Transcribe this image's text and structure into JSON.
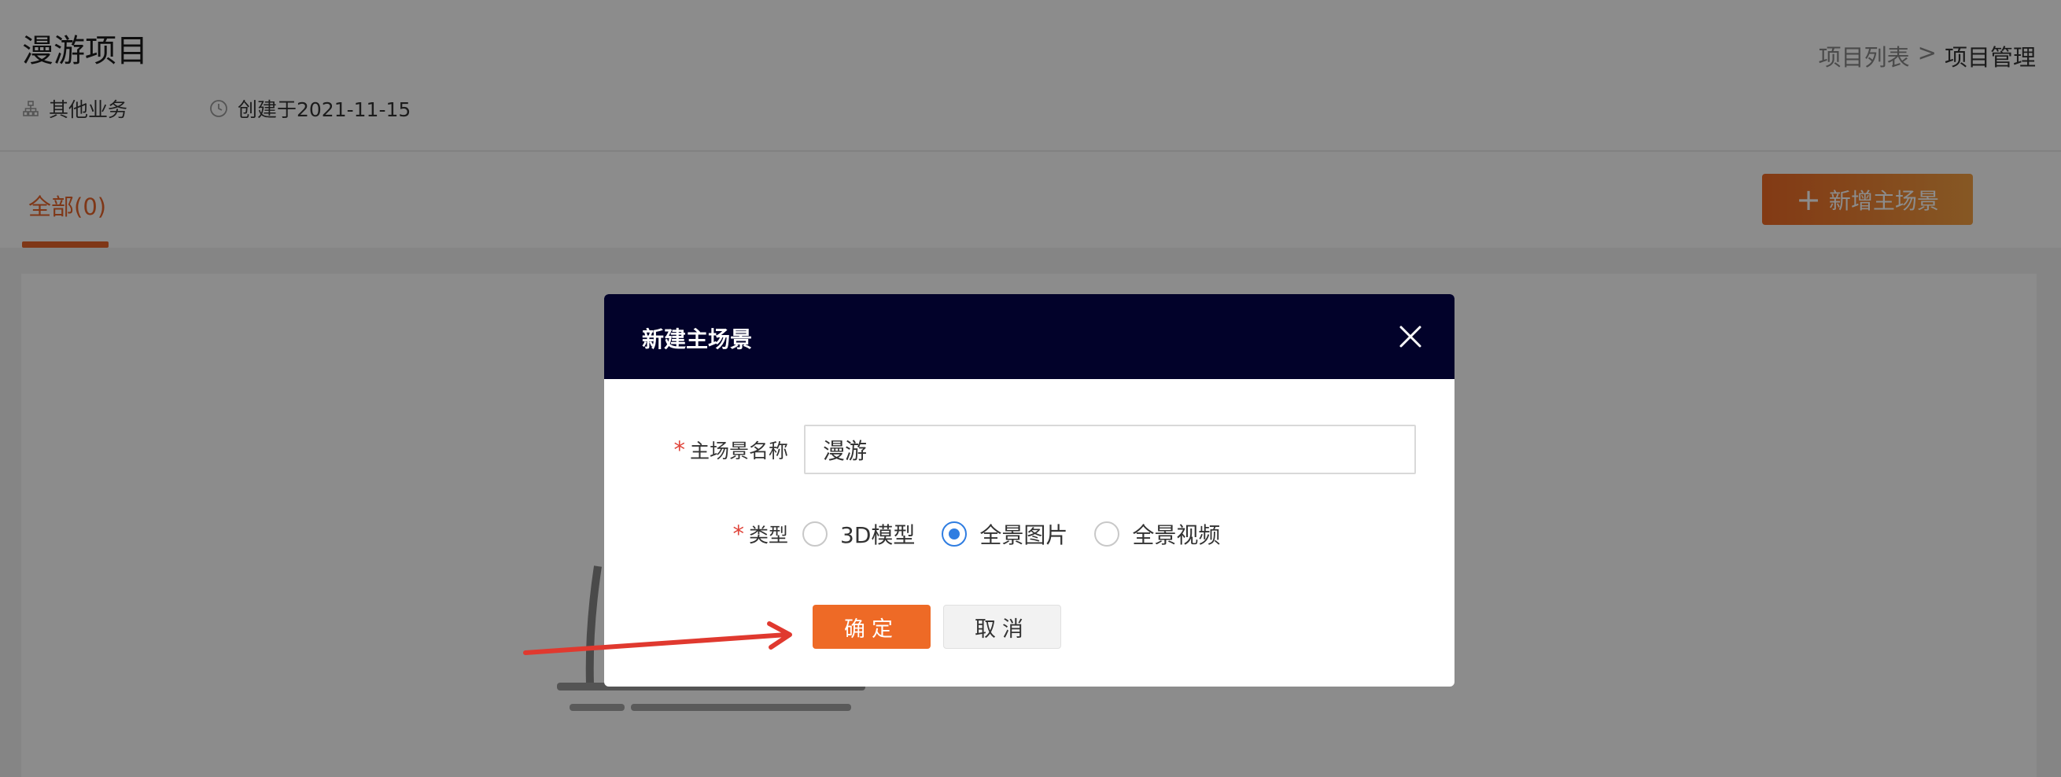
{
  "page": {
    "title": "漫游项目",
    "business": "其他业务",
    "created": "创建于2021-11-15"
  },
  "breadcrumb": {
    "parent": "项目列表",
    "separator": ">",
    "current": "项目管理"
  },
  "tabs": [
    {
      "label": "全部(0)",
      "active": true
    }
  ],
  "toolbar": {
    "add_plus": "+",
    "add_label": "新增主场景"
  },
  "modal": {
    "title": "新建主场景",
    "name_required": "*",
    "name_label": "主场景名称",
    "name_value": "漫游",
    "type_required": "*",
    "type_label": "类型",
    "type_options": [
      {
        "label": "3D模型",
        "checked": false
      },
      {
        "label": "全景图片",
        "checked": true
      },
      {
        "label": "全景视频",
        "checked": false
      }
    ],
    "ok_label": "确定",
    "cancel_label": "取消"
  },
  "colors": {
    "accent": "#ee6a26",
    "modal_header": "#02022a",
    "radio_checked": "#2f7de1",
    "annotation_arrow": "#e0392f"
  },
  "icons": {
    "business": "org-chart-icon",
    "created": "clock-icon",
    "add": "plus-icon",
    "close": "close-icon"
  }
}
